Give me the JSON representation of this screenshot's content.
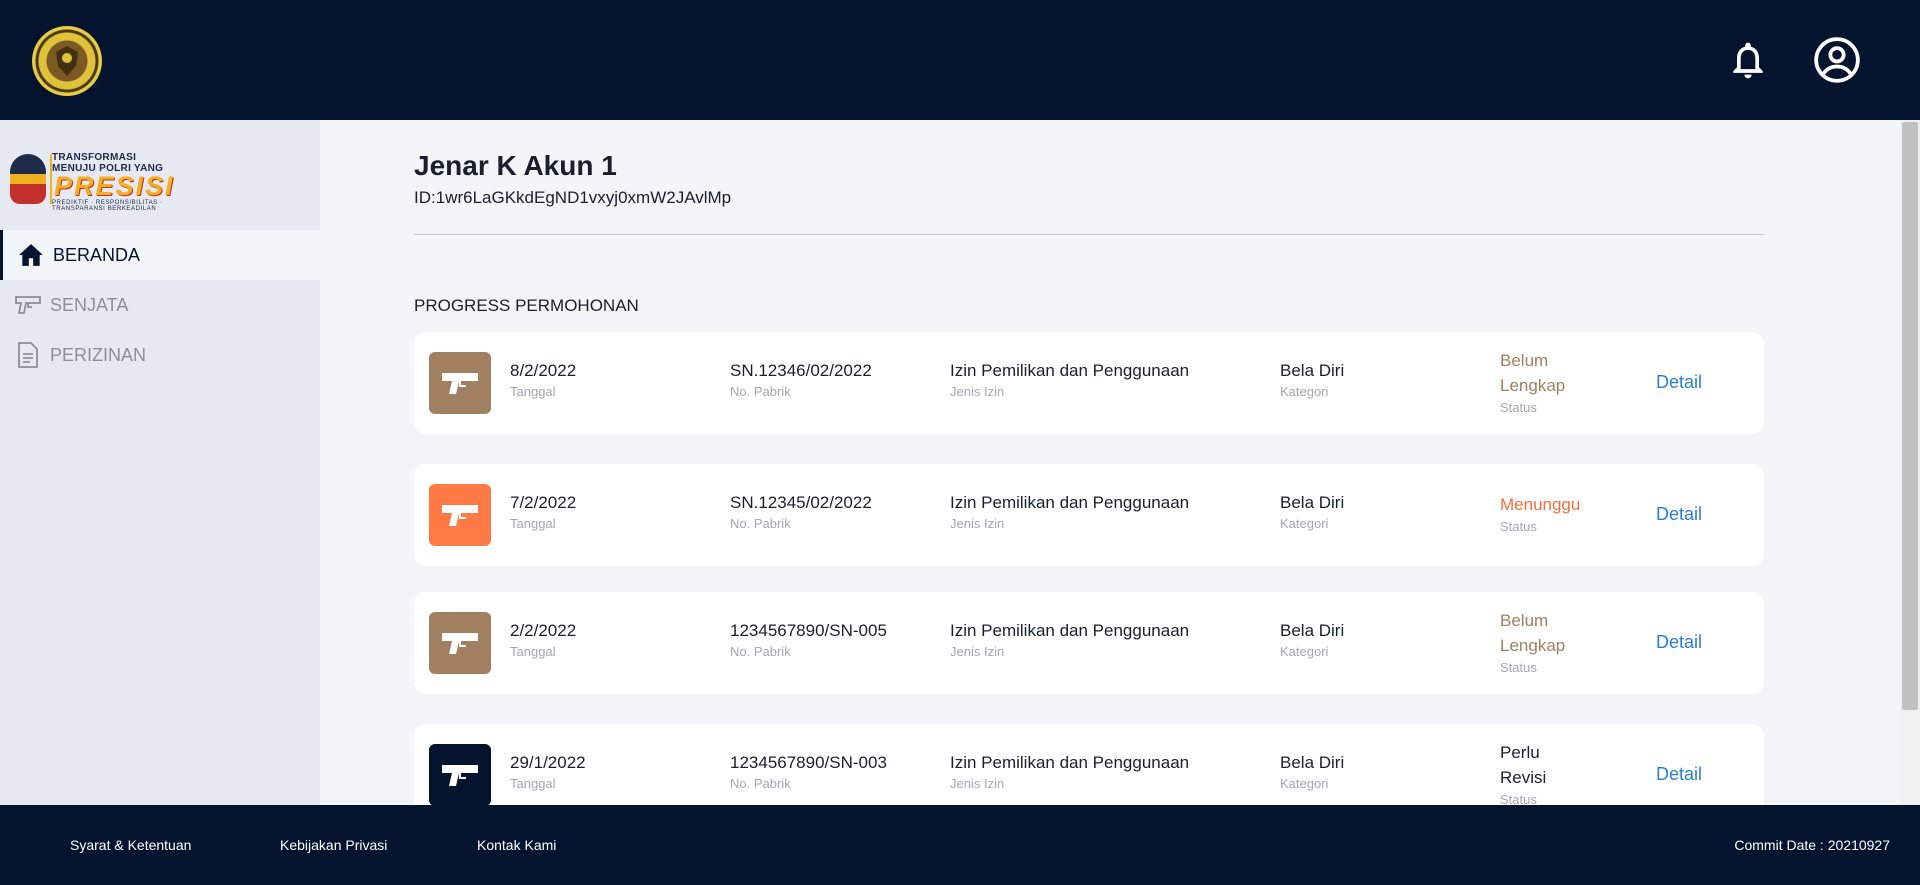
{
  "header": {
    "emblem_icon": "police-emblem",
    "notifications_icon": "bell-icon",
    "account_icon": "account-circle-icon"
  },
  "sidebar": {
    "logo": {
      "line1": "TRANSFORMASI",
      "line2": "MENUJU POLRI YANG",
      "wordmark": "PRESISI",
      "tagline": "PREDIKTIF · RESPONSIBILITAS · TRANSPARANSI BERKEADILAN"
    },
    "items": [
      {
        "label": "BERANDA",
        "icon": "home-icon",
        "active": true
      },
      {
        "label": "SENJATA",
        "icon": "gun-icon",
        "active": false
      },
      {
        "label": "PERIZINAN",
        "icon": "document-icon",
        "active": false
      }
    ]
  },
  "user": {
    "name": "Jenar K Akun 1",
    "id": "ID:1wr6LaGKkdEgND1vxyj0xmW2JAvlMp"
  },
  "progress": {
    "title": "PROGRESS PERMOHONAN",
    "labels": {
      "date": "Tanggal",
      "serial": "No. Pabrik",
      "type": "Jenis Izin",
      "category": "Kategori",
      "status": "Status",
      "detail": "Detail"
    },
    "rows": [
      {
        "date": "8/2/2022",
        "serial": "SN.12346/02/2022",
        "type": "Izin Pemilikan dan Penggunaan",
        "category": "Bela Diri",
        "status_line1": "Belum",
        "status_line2": "Lengkap",
        "status_color": "#a08060",
        "thumb_color": "#a08060"
      },
      {
        "date": "7/2/2022",
        "serial": "SN.12345/02/2022",
        "type": "Izin Pemilikan dan Penggunaan",
        "category": "Bela Diri",
        "status_line1": "Menunggu",
        "status_line2": "",
        "status_color": "#f26f3f",
        "thumb_color": "#ff7a45"
      },
      {
        "date": "2/2/2022",
        "serial": "1234567890/SN-005",
        "type": "Izin Pemilikan dan Penggunaan",
        "category": "Bela Diri",
        "status_line1": "Belum",
        "status_line2": "Lengkap",
        "status_color": "#a08060",
        "thumb_color": "#a08060"
      },
      {
        "date": "29/1/2022",
        "serial": "1234567890/SN-003",
        "type": "Izin Pemilikan dan Penggunaan",
        "category": "Bela Diri",
        "status_line1": "Perlu",
        "status_line2": "Revisi",
        "status_color": "#1a1f2e",
        "thumb_color": "#04132e"
      }
    ]
  },
  "footer": {
    "links": [
      "Syarat & Ketentuan",
      "Kebijakan Privasi",
      "Kontak Kami"
    ],
    "commit": "Commit Date : 20210927"
  },
  "colors": {
    "navy": "#04132e",
    "link_blue": "#2a7fd4",
    "pending_orange": "#f26f3f",
    "incomplete_brown": "#a08060"
  }
}
